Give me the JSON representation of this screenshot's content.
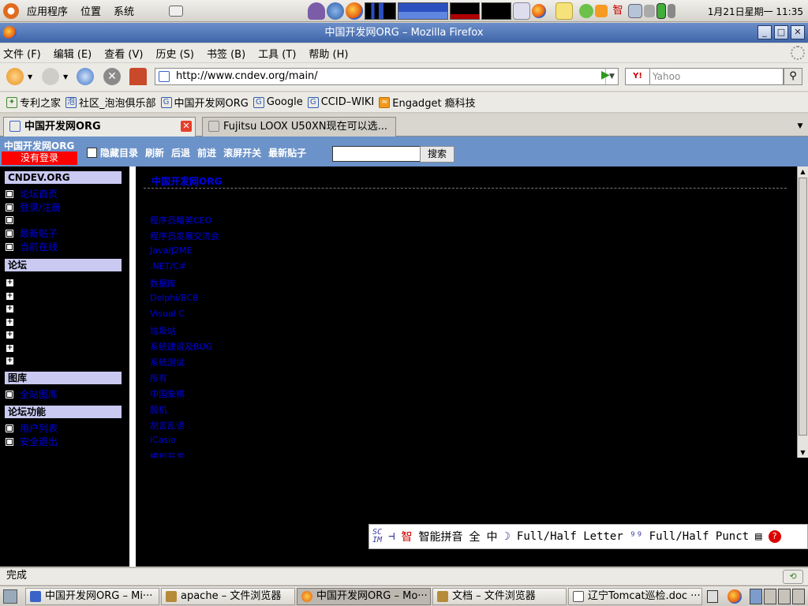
{
  "top_panel": {
    "menus": [
      "应用程序",
      "位置",
      "系统"
    ],
    "clock": "1月21日星期一 11:35"
  },
  "window": {
    "title": "中国开发网ORG – Mozilla Firefox"
  },
  "menubar": [
    "文件 (F)",
    "编辑 (E)",
    "查看 (V)",
    "历史 (S)",
    "书签 (B)",
    "工具 (T)",
    "帮助 (H)"
  ],
  "navbar": {
    "url": "http://www.cndev.org/main/",
    "search_engine": "Y!",
    "search_placeholder": "Yahoo"
  },
  "bookmarks": [
    {
      "label": "专利之家",
      "icon": "leaf-icon"
    },
    {
      "label": "社区_泡泡俱乐部",
      "icon": "site-icon"
    },
    {
      "label": "中国开发网ORG",
      "icon": "site-icon"
    },
    {
      "label": "Google",
      "icon": "site-icon"
    },
    {
      "label": "CCID–WIKI",
      "icon": "site-icon"
    },
    {
      "label": "Engadget 瘾科技",
      "icon": "rss-icon"
    }
  ],
  "tabs": [
    {
      "label": "中国开发网ORG",
      "active": true
    },
    {
      "label": "Fujitsu LOOX U50XN现在可以选...",
      "active": false
    }
  ],
  "site": {
    "name": "中国开发网ORG",
    "login_status": "没有登录",
    "links": [
      "隐藏目录",
      "刷新",
      "后退",
      "前进",
      "滚屏开关",
      "最新贴子"
    ],
    "search_button": "搜索"
  },
  "leftnav": {
    "section1": {
      "title": "CNDEV.ORG",
      "items": [
        "论坛首页",
        "登录/注册",
        "",
        "最新贴子",
        "当前在线"
      ]
    },
    "section2": {
      "title": "论坛",
      "count_collapsed": 7
    },
    "section3": {
      "title": "图库",
      "items": [
        "全站图库"
      ]
    },
    "section4": {
      "title": "论坛功能",
      "items": [
        "用户列表",
        "安全退出"
      ]
    }
  },
  "content": {
    "title": "中国开发网ORG",
    "forums": [
      "程序员精英CEO",
      "程序员发展交流会",
      "Java/J2ME",
      ".NET/C#",
      "数据库",
      "Delphi/BCB",
      "Visual C",
      "垃圾站",
      "系统建设及BUG",
      "系统测试",
      "所有",
      "中国象棋",
      "股机",
      "胡言乱语",
      "iCasio",
      "模拟开发"
    ]
  },
  "ime": {
    "mode": "智能拼音",
    "width": "全",
    "lang": "中",
    "full_half_letter": "Full/Half Letter",
    "full_half_punct": "Full/Half Punct"
  },
  "statusbar": {
    "text": "完成"
  },
  "taskbar": [
    {
      "label": "中国开发网ORG – Mi···",
      "active": false
    },
    {
      "label": "apache – 文件浏览器",
      "active": false
    },
    {
      "label": "中国开发网ORG – Mo···",
      "active": true
    },
    {
      "label": "文档 – 文件浏览器",
      "active": false
    },
    {
      "label": "辽宁Tomcat巡检.doc ···",
      "active": false
    }
  ],
  "colors": {
    "site_bar": "#6c93c9",
    "login_badge": "#ff0000",
    "link": "#0000e0",
    "section_header": "#c9c9f2",
    "title_bar": "#3f65a8"
  }
}
